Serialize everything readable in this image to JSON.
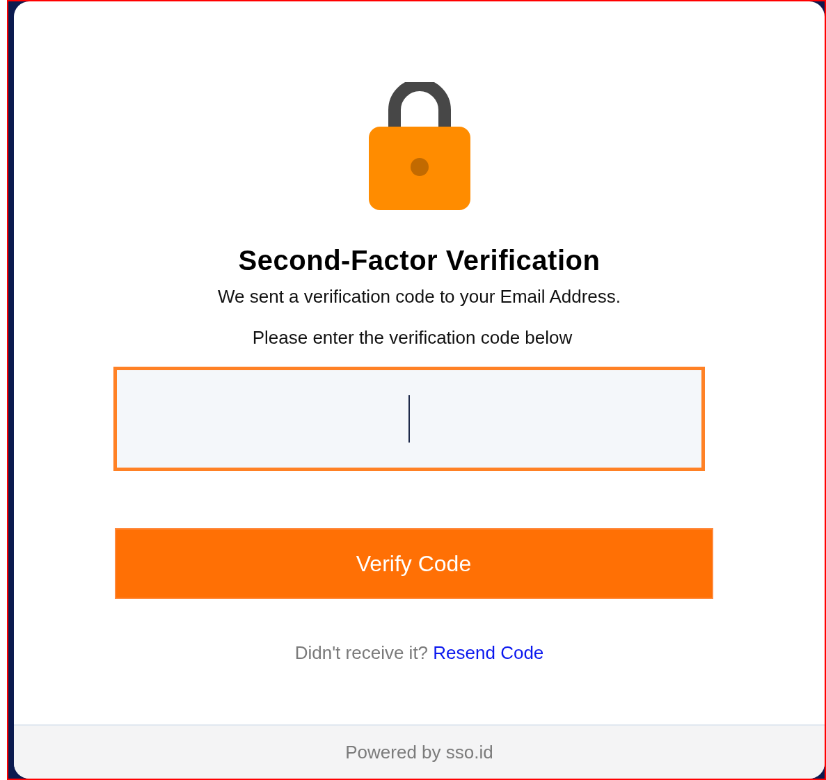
{
  "title": "Second-Factor Verification",
  "subtitle": "We sent a verification code to your Email Address.",
  "instruction": "Please enter the verification code below",
  "code_field": {
    "focused": true
  },
  "verify_button": {
    "label": "Verify Code"
  },
  "resend": {
    "prompt": "Didn't receive it?",
    "link": "Resend Code"
  },
  "footer": "Powered by sso.id"
}
